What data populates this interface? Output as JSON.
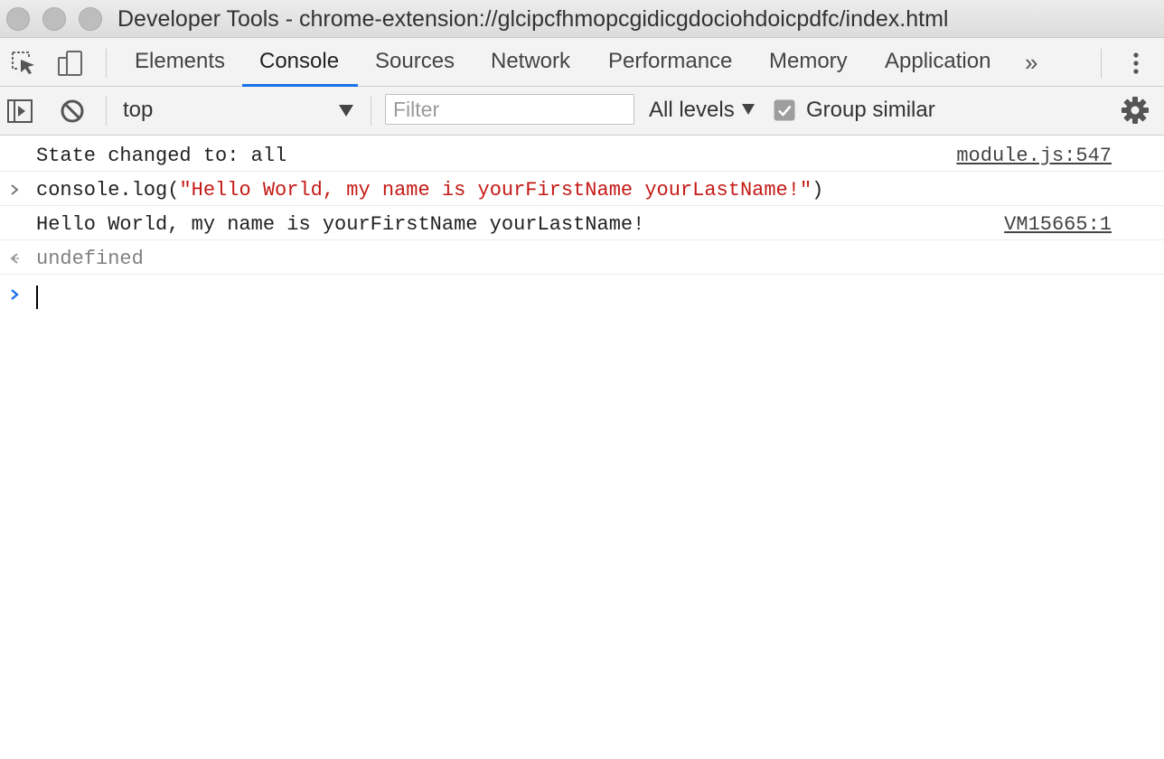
{
  "window": {
    "title": "Developer Tools - chrome-extension://glcipcfhmopcgidicgdociohdoicpdfc/index.html"
  },
  "tabs": [
    {
      "label": "Elements",
      "active": false
    },
    {
      "label": "Console",
      "active": true
    },
    {
      "label": "Sources",
      "active": false
    },
    {
      "label": "Network",
      "active": false
    },
    {
      "label": "Performance",
      "active": false
    },
    {
      "label": "Memory",
      "active": false
    },
    {
      "label": "Application",
      "active": false
    }
  ],
  "tabs_more": "»",
  "console_toolbar": {
    "context": "top",
    "filter_placeholder": "Filter",
    "levels": "All levels",
    "group_similar_label": "Group similar",
    "group_similar_checked": true
  },
  "messages": [
    {
      "type": "log",
      "text": "State changed to: all",
      "source": "module.js:547"
    },
    {
      "type": "input",
      "prefix": "console.log(",
      "string": "\"Hello World, my name is yourFirstName yourLastName!\"",
      "suffix": ")"
    },
    {
      "type": "log",
      "text": "Hello World, my name is yourFirstName yourLastName!",
      "source": "VM15665:1"
    },
    {
      "type": "result",
      "text": "undefined"
    }
  ],
  "colors": {
    "accent": "#1a73e8",
    "string": "#c41a16",
    "muted": "#808080"
  },
  "icons": {
    "inspect": "inspect-element-icon",
    "device": "device-toolbar-icon",
    "sidebar": "show-sidebar-icon",
    "clear": "clear-console-icon",
    "settings": "gear-icon",
    "menu": "kebab-menu-icon"
  }
}
